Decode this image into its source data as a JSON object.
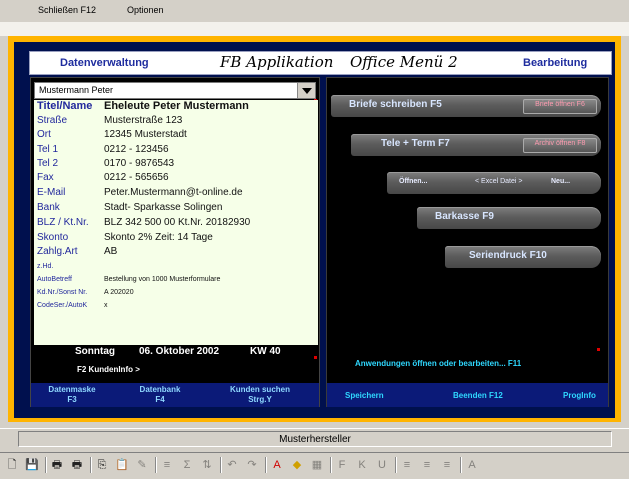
{
  "menubar": {
    "items": [
      "Schließen F12",
      "Optionen"
    ]
  },
  "header": {
    "left": "Datenverwaltung",
    "script_title": "FB Applikation",
    "script_subtitle": "Office Menü 2",
    "right": "Bearbeitung"
  },
  "combo": {
    "value": "Mustermann Peter"
  },
  "card": {
    "rows": [
      {
        "label": "Titel/Name",
        "value": "Eheleute Peter Mustermann",
        "style": "bold"
      },
      {
        "label": "Straße",
        "value": "Musterstraße 123",
        "style": "normal"
      },
      {
        "label": "Ort",
        "value": "12345 Musterstadt",
        "style": "normal"
      },
      {
        "label": "Tel 1",
        "value": "0212 - 123456",
        "style": "normal"
      },
      {
        "label": "Tel 2",
        "value": "0170 - 9876543",
        "style": "normal"
      },
      {
        "label": "Fax",
        "value": "0212 - 565656",
        "style": "normal"
      },
      {
        "label": "E-Mail",
        "value": "Peter.Mustermann@t-online.de",
        "style": "normal"
      },
      {
        "label": "Bank",
        "value": "Stadt- Sparkasse Solingen",
        "style": "normal"
      },
      {
        "label": "BLZ / Kt.Nr.",
        "value": "BLZ  342 500 00     Kt.Nr. 20182930",
        "style": "normal"
      },
      {
        "label": "Skonto",
        "value": "Skonto 2%      Zeit: 14 Tage",
        "style": "normal"
      },
      {
        "label": "Zahlg.Art",
        "value": "AB",
        "style": "normal"
      },
      {
        "label": "z.Hd.",
        "value": "",
        "style": "small"
      },
      {
        "label": "AutoBetreff",
        "value": "Bestellung von 1000 Musterformulare",
        "style": "small"
      },
      {
        "label": "Kd.Nr./Sonst Nr.",
        "value": "A 202020",
        "style": "small"
      },
      {
        "label": "CodeSer./AutoK",
        "value": "x",
        "style": "small"
      }
    ]
  },
  "dateline": {
    "day": "Sonntag",
    "date": "06. Oktober 2002",
    "week": "KW  40"
  },
  "kundeninfo": "F2  KundenInfo >",
  "left_buttons": [
    {
      "line1": "Datenmaske",
      "line2": "F3"
    },
    {
      "line1": "Datenbank",
      "line2": "F4"
    },
    {
      "line1": "Kunden suchen",
      "line2": "Strg.Y"
    }
  ],
  "right_menu": {
    "briefe": "Briefe schreiben  F5",
    "briefe_oeffnen": "Briefe öffnen  F6",
    "tele": "Tele + Term  F7",
    "archiv": "Archiv öffnen  F8",
    "oeffnen": "Öffnen...",
    "excel": "< Excel Datei >",
    "neu": "Neu...",
    "barkasse": "Barkasse  F9",
    "serien": "Seriendruck  F10",
    "anwendungen": "Anwendungen  öffnen oder bearbeiten...  F11"
  },
  "right_buttons": [
    "Speichern",
    "Beenden  F12",
    "ProgInfo"
  ],
  "status": {
    "text": "Musterhersteller"
  },
  "toolbar": {
    "icons": [
      "print-preview-icon",
      "save-icon",
      "print-icon",
      "print-setup-icon",
      "copy-icon",
      "paste-icon",
      "format-painter-icon",
      "align-icon",
      "sum-icon",
      "sort-icon",
      "undo-icon",
      "redo-icon",
      "font-color-icon",
      "fill-color-icon",
      "border-icon",
      "bold-icon",
      "italic-icon",
      "underline-icon",
      "align-left-icon",
      "align-center-icon",
      "align-right-icon",
      "font-size-icon"
    ]
  },
  "colors": {
    "frame_orange": "#ffb400",
    "navy": "#00104e",
    "card_bg": "#f6ffe8",
    "label_blue": "#22289c",
    "cyan": "#2fd8ff"
  }
}
